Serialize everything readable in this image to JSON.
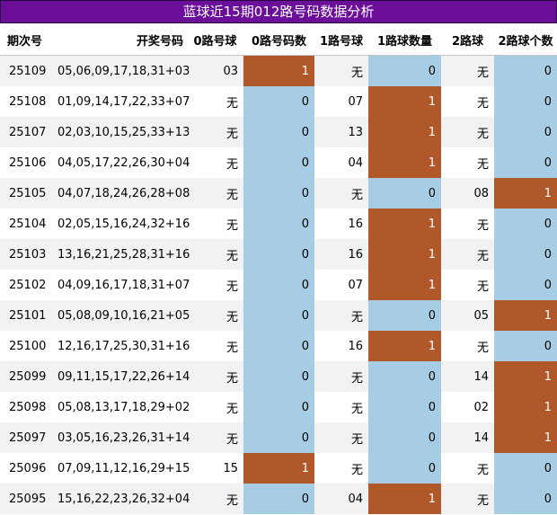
{
  "title": "蓝球近15期012路号码数据分析",
  "headers": [
    "期次号",
    "开奖号码",
    "0路号球",
    "0路号码数",
    "1路号球",
    "1路球数量",
    "2路球",
    "2路球个数"
  ],
  "rows": [
    {
      "period": "25109",
      "numbers": "05,06,09,17,18,31+03",
      "r0": "03",
      "c0": "1",
      "r1": "无",
      "c1": "0",
      "r2": "无",
      "c2": "0"
    },
    {
      "period": "25108",
      "numbers": "01,09,14,17,22,33+07",
      "r0": "无",
      "c0": "0",
      "r1": "07",
      "c1": "1",
      "r2": "无",
      "c2": "0"
    },
    {
      "period": "25107",
      "numbers": "02,03,10,15,25,33+13",
      "r0": "无",
      "c0": "0",
      "r1": "13",
      "c1": "1",
      "r2": "无",
      "c2": "0"
    },
    {
      "period": "25106",
      "numbers": "04,05,17,22,26,30+04",
      "r0": "无",
      "c0": "0",
      "r1": "04",
      "c1": "1",
      "r2": "无",
      "c2": "0"
    },
    {
      "period": "25105",
      "numbers": "04,07,18,24,26,28+08",
      "r0": "无",
      "c0": "0",
      "r1": "无",
      "c1": "0",
      "r2": "08",
      "c2": "1"
    },
    {
      "period": "25104",
      "numbers": "02,05,15,16,24,32+16",
      "r0": "无",
      "c0": "0",
      "r1": "16",
      "c1": "1",
      "r2": "无",
      "c2": "0"
    },
    {
      "period": "25103",
      "numbers": "13,16,21,25,28,31+16",
      "r0": "无",
      "c0": "0",
      "r1": "16",
      "c1": "1",
      "r2": "无",
      "c2": "0"
    },
    {
      "period": "25102",
      "numbers": "04,09,16,17,18,31+07",
      "r0": "无",
      "c0": "0",
      "r1": "07",
      "c1": "1",
      "r2": "无",
      "c2": "0"
    },
    {
      "period": "25101",
      "numbers": "05,08,09,10,16,21+05",
      "r0": "无",
      "c0": "0",
      "r1": "无",
      "c1": "0",
      "r2": "05",
      "c2": "1"
    },
    {
      "period": "25100",
      "numbers": "12,16,17,25,30,31+16",
      "r0": "无",
      "c0": "0",
      "r1": "16",
      "c1": "1",
      "r2": "无",
      "c2": "0"
    },
    {
      "period": "25099",
      "numbers": "09,11,15,17,22,26+14",
      "r0": "无",
      "c0": "0",
      "r1": "无",
      "c1": "0",
      "r2": "14",
      "c2": "1"
    },
    {
      "period": "25098",
      "numbers": "05,08,13,17,18,29+02",
      "r0": "无",
      "c0": "0",
      "r1": "无",
      "c1": "0",
      "r2": "02",
      "c2": "1"
    },
    {
      "period": "25097",
      "numbers": "03,05,16,23,26,31+14",
      "r0": "无",
      "c0": "0",
      "r1": "无",
      "c1": "0",
      "r2": "14",
      "c2": "1"
    },
    {
      "period": "25096",
      "numbers": "07,09,11,12,16,29+15",
      "r0": "15",
      "c0": "1",
      "r1": "无",
      "c1": "0",
      "r2": "无",
      "c2": "0"
    },
    {
      "period": "25095",
      "numbers": "15,16,22,23,26,32+04",
      "r0": "无",
      "c0": "0",
      "r1": "04",
      "c1": "1",
      "r2": "无",
      "c2": "0"
    }
  ],
  "colors": {
    "title_bg": "#6b0f9a",
    "count_zero_bg": "#a6cde3",
    "count_one_bg": "#b0582a"
  }
}
